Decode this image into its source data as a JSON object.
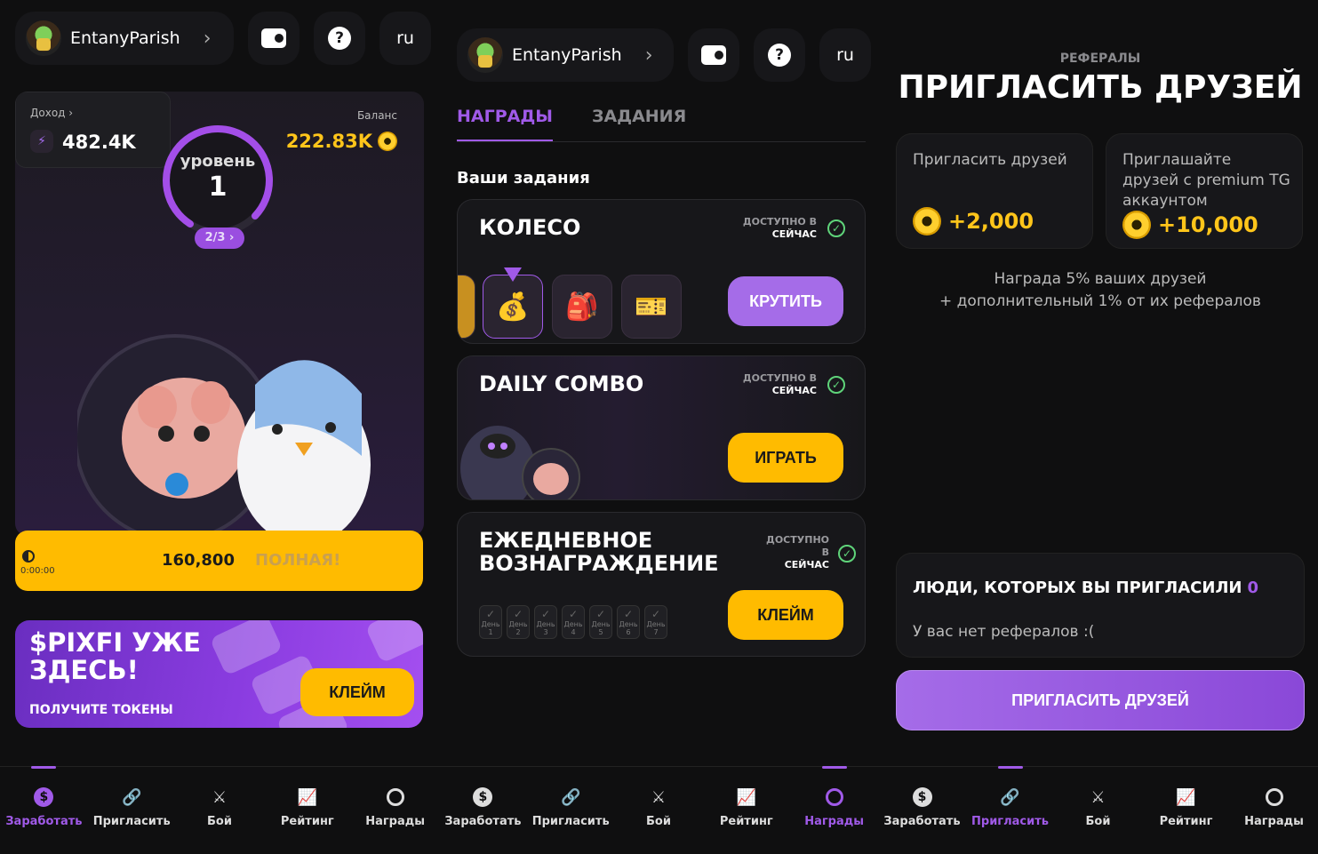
{
  "user": {
    "name": "EntanyParish"
  },
  "lang": "ru",
  "earn": {
    "income_label": "Доход",
    "income_value": "482.4K",
    "balance_label": "Баланс",
    "balance_value": "222.83K",
    "level_label": "уровень",
    "level_number": "1",
    "level_progress": "2/3",
    "charge_value": "160,800",
    "charge_state": "ПОЛНАЯ!",
    "timer": "0:00:00",
    "promo_title": "$PIXFI УЖЕ ЗДЕСЬ!",
    "promo_sub": "ПОЛУЧИТЕ ТОКЕНЫ",
    "promo_button": "КЛЕЙМ"
  },
  "rewards": {
    "tabs": [
      "НАГРАДЫ",
      "ЗАДАНИЯ"
    ],
    "section_title": "Ваши задания",
    "tasks": [
      {
        "title": "КОЛЕСО",
        "avail_1": "ДОСТУПНО В",
        "avail_2": "СЕЙЧАС",
        "button": "КРУТИТЬ"
      },
      {
        "title": "DAILY COMBO",
        "avail_1": "ДОСТУПНО В",
        "avail_2": "СЕЙЧАС",
        "button": "ИГРАТЬ"
      },
      {
        "title": "ЕЖЕДНЕВНОЕ ВОЗНАГРАЖДЕНИЕ",
        "avail_1": "ДОСТУПНО",
        "avail_mid": "В",
        "avail_2": "СЕЙЧАС",
        "button": "КЛЕЙМ"
      }
    ],
    "day_labels": [
      "День 1",
      "День 2",
      "День 3",
      "День 4",
      "День 5",
      "День 6",
      "День 7"
    ]
  },
  "referrals": {
    "label": "РЕФЕРАЛЫ",
    "title": "ПРИГЛАСИТЬ ДРУЗЕЙ",
    "card1_text": "Пригласить друзей",
    "card1_value": "+2,000",
    "card2_text": "Приглашайте друзей с premium TG аккаунтом",
    "card2_value": "+10,000",
    "note_line1": "Награда 5% ваших друзей",
    "note_line2": "+ дополнительный 1% от их рефералов",
    "people_title": "ЛЮДИ, КОТОРЫХ ВЫ ПРИГЛАСИЛИ",
    "people_count": "0",
    "people_empty": "У вас нет рефералов :(",
    "invite_button": "ПРИГЛАСИТЬ ДРУЗЕЙ"
  },
  "nav": [
    "Заработать",
    "Пригласить",
    "Бой",
    "Рейтинг",
    "Награды"
  ],
  "colors": {
    "accent": "#a05ae8",
    "yellow": "#ffbb00",
    "gold": "#ffc51a",
    "bg": "#0f0f10"
  }
}
